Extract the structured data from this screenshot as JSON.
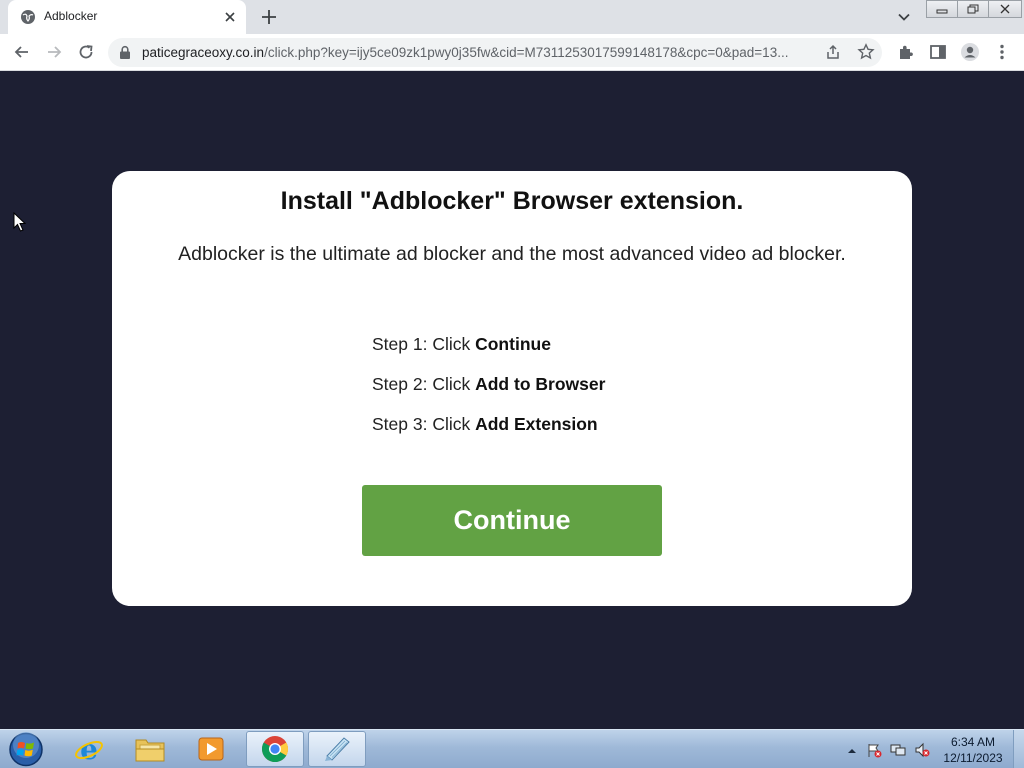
{
  "browser": {
    "tab": {
      "title": "Adblocker"
    },
    "url": {
      "host": "paticegraceoxy.co.in",
      "path": "/click.php?key=ijy5ce09zk1pwy0j35fw&cid=M7311253017599148178&cpc=0&pad=13..."
    },
    "icons": {
      "back": "back-arrow-icon",
      "forward": "forward-arrow-icon",
      "reload": "reload-icon",
      "share": "share-icon",
      "bookmark": "star-icon",
      "extensions": "puzzle-icon",
      "side_panel": "side-panel-icon",
      "profile": "profile-icon",
      "menu": "kebab-menu-icon"
    }
  },
  "page": {
    "title": "Install \"Adblocker\" Browser extension.",
    "description": "Adblocker is the ultimate ad blocker and the most advanced video ad blocker.",
    "steps": [
      {
        "prefix": "Step 1: Click ",
        "action": "Continue"
      },
      {
        "prefix": "Step 2: Click ",
        "action": "Add to Browser"
      },
      {
        "prefix": "Step 3: Click ",
        "action": "Add Extension"
      }
    ],
    "button_label": "Continue",
    "colors": {
      "background": "#1d1f33",
      "card": "#ffffff",
      "button": "#62a244"
    }
  },
  "taskbar": {
    "apps": [
      "internet-explorer",
      "file-explorer",
      "media-player",
      "chrome",
      "notepad"
    ],
    "clock": {
      "time": "6:34 AM",
      "date": "12/11/2023"
    }
  }
}
